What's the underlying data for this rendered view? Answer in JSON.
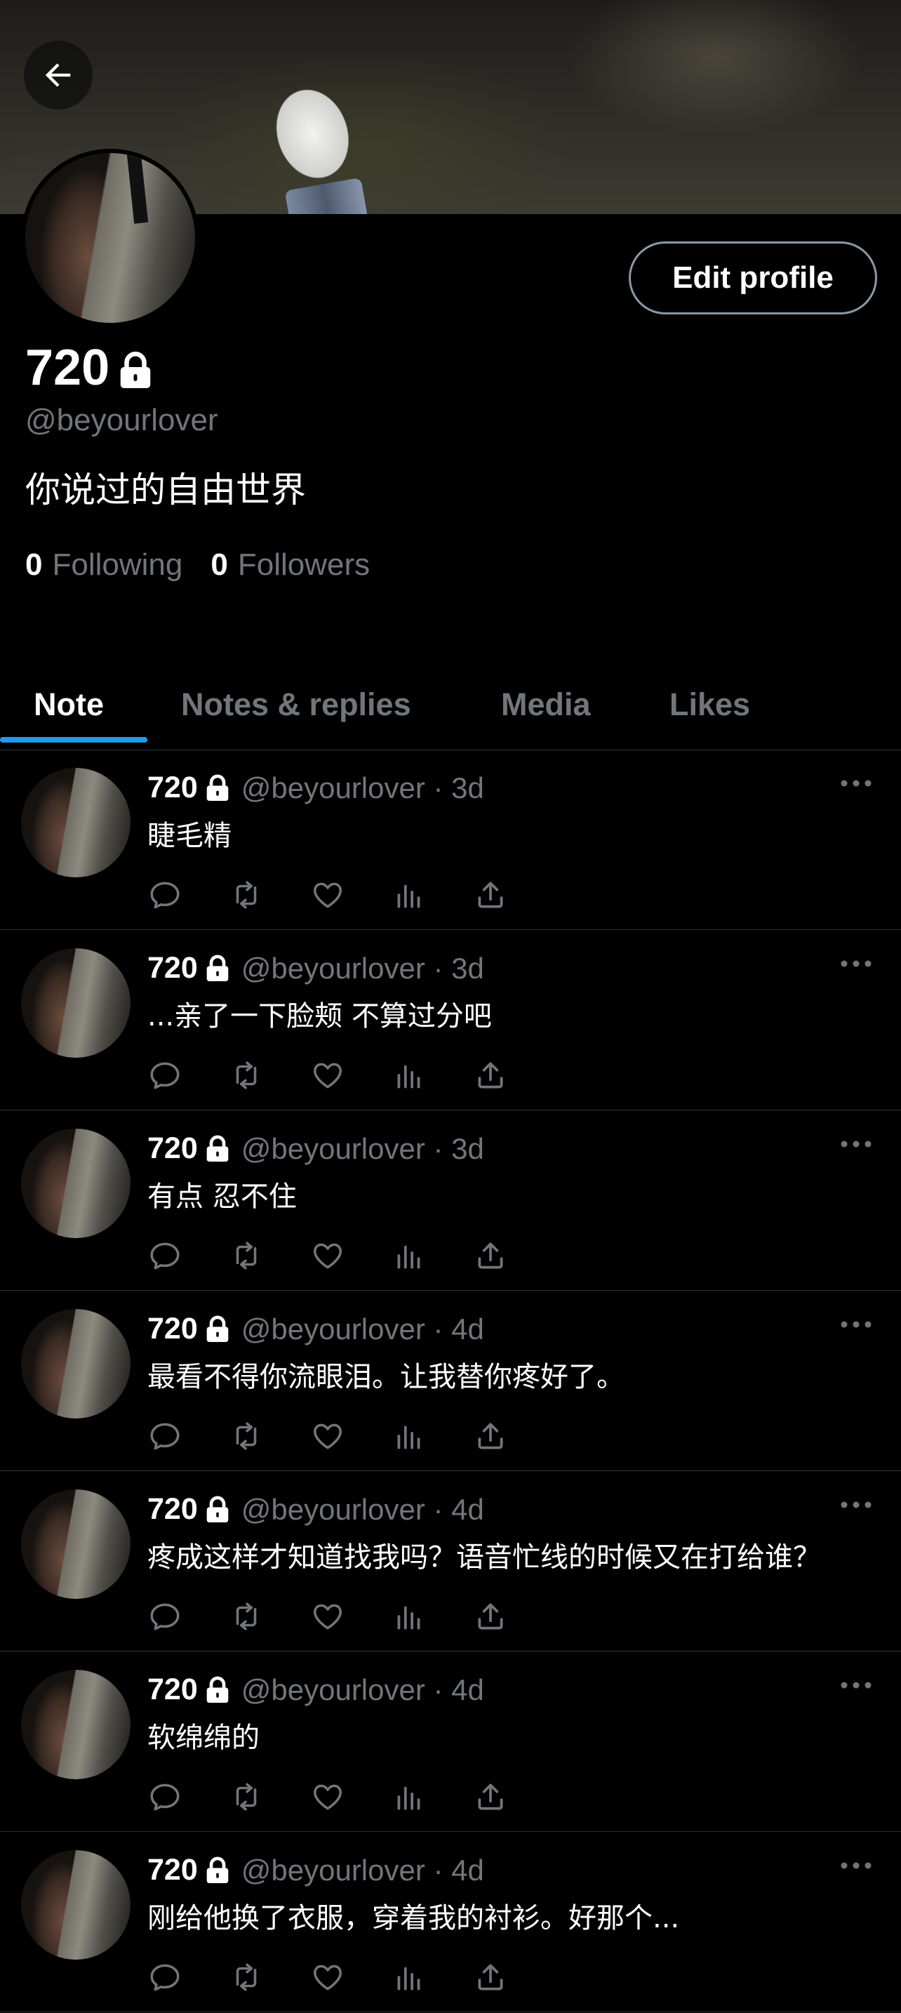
{
  "profile": {
    "display_name": "720",
    "handle": "@beyourlover",
    "bio": "你说过的自由世界",
    "following_count": "0",
    "following_label": "Following",
    "followers_count": "0",
    "followers_label": "Followers",
    "edit_button": "Edit profile"
  },
  "tabs": [
    {
      "label": "Note",
      "active": true
    },
    {
      "label": "Notes & replies",
      "active": false
    },
    {
      "label": "Media",
      "active": false
    },
    {
      "label": "Likes",
      "active": false
    }
  ],
  "posts": [
    {
      "name": "720",
      "meta": "@beyourlover · 3d",
      "text": "睫毛精"
    },
    {
      "name": "720",
      "meta": "@beyourlover · 3d",
      "text": "...亲了一下脸颊 不算过分吧"
    },
    {
      "name": "720",
      "meta": "@beyourlover · 3d",
      "text": "有点 忍不住"
    },
    {
      "name": "720",
      "meta": "@beyourlover · 4d",
      "text": "最看不得你流眼泪。让我替你疼好了。"
    },
    {
      "name": "720",
      "meta": "@beyourlover · 4d",
      "text": "疼成这样才知道找我吗？语音忙线的时候又在打给谁？"
    },
    {
      "name": "720",
      "meta": "@beyourlover · 4d",
      "text": "软绵绵的"
    },
    {
      "name": "720",
      "meta": "@beyourlover · 4d",
      "text": "刚给他换了衣服，穿着我的衬衫。好那个..."
    }
  ],
  "icons": {
    "back": "arrow-left-icon",
    "lock": "lock-icon",
    "more": "more-horizontal-icon",
    "reply": "reply-icon",
    "repost": "repost-icon",
    "like": "heart-icon",
    "views": "analytics-icon",
    "share": "share-icon"
  },
  "colors": {
    "background": "#000000",
    "accent": "#1d9bf0",
    "muted_text": "#71767b",
    "divider": "#2f3336"
  }
}
